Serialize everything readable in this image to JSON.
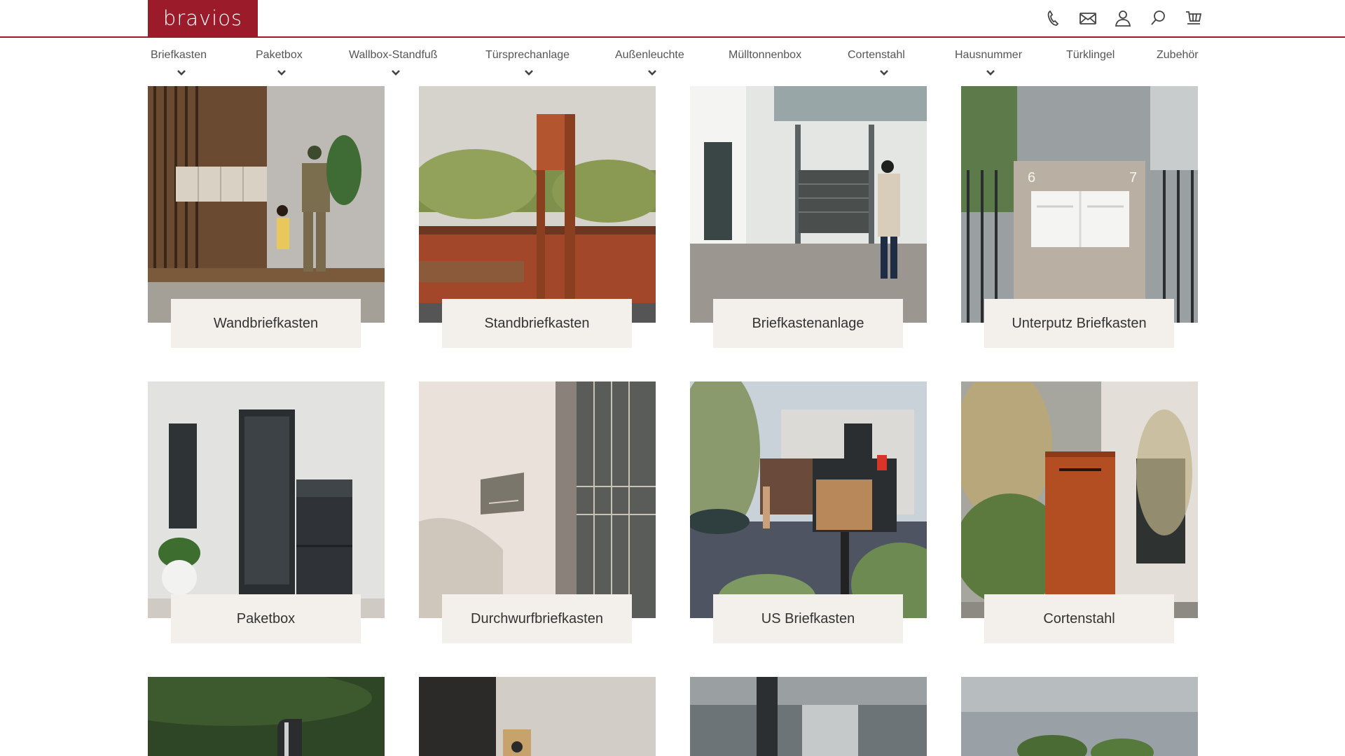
{
  "brand": {
    "logo_text": "bravios",
    "color": "#9b1b2a"
  },
  "header_icons": [
    "phone-icon",
    "mail-icon",
    "user-icon",
    "search-icon",
    "cart-icon"
  ],
  "nav": [
    {
      "label": "Briefkasten",
      "has_dropdown": true
    },
    {
      "label": "Paketbox",
      "has_dropdown": true
    },
    {
      "label": "Wallbox-Standfuß",
      "has_dropdown": true
    },
    {
      "label": "Türsprechanlage",
      "has_dropdown": true
    },
    {
      "label": "Außenleuchte",
      "has_dropdown": true
    },
    {
      "label": "Mülltonnenbox",
      "has_dropdown": false
    },
    {
      "label": "Cortenstahl",
      "has_dropdown": true
    },
    {
      "label": "Hausnummer",
      "has_dropdown": true
    },
    {
      "label": "Türklingel",
      "has_dropdown": false
    },
    {
      "label": "Zubehör",
      "has_dropdown": false
    }
  ],
  "categories": [
    {
      "label": "Wandbriefkasten"
    },
    {
      "label": "Standbriefkasten"
    },
    {
      "label": "Briefkastenanlage"
    },
    {
      "label": "Unterputz Briefkasten"
    },
    {
      "label": "Paketbox"
    },
    {
      "label": "Durchwurfbriefkasten"
    },
    {
      "label": "US Briefkasten"
    },
    {
      "label": "Cortenstahl"
    }
  ],
  "unterputz_numbers": {
    "left": "6",
    "right": "7"
  }
}
